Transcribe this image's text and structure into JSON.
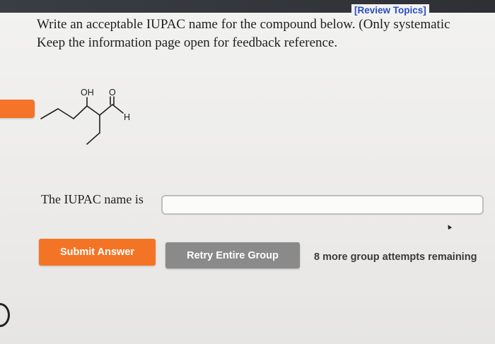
{
  "header": {
    "review_link": "[Review Topics]"
  },
  "question": {
    "line1": "Write an acceptable IUPAC name for the compound below. (Only systematic",
    "line2": "Keep the information page open for feedback reference."
  },
  "structure": {
    "label_oh": "OH",
    "label_o": "O",
    "label_h": "H"
  },
  "answer": {
    "label": "The IUPAC name is",
    "value": ""
  },
  "actions": {
    "submit_label": "Submit Answer",
    "retry_label": "Retry Entire Group",
    "attempts_text": "8 more group attempts remaining"
  },
  "colors": {
    "accent": "#f47426",
    "link": "#2a4fc0",
    "retry": "#8a8a8a"
  }
}
